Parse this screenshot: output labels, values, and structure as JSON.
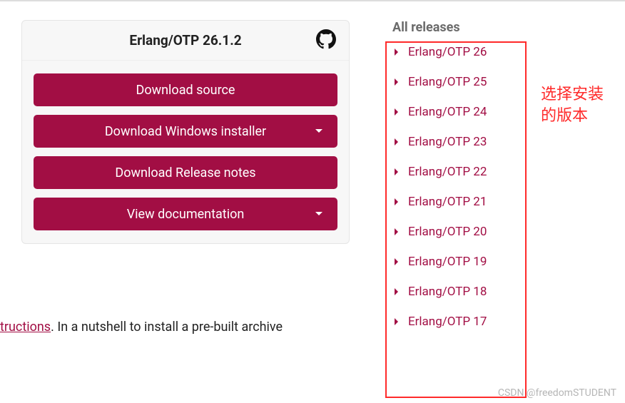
{
  "card": {
    "title": "Erlang/OTP 26.1.2",
    "github_icon": "github-icon",
    "buttons": [
      {
        "label": "Download source",
        "has_caret": false
      },
      {
        "label": "Download Windows installer",
        "has_caret": true
      },
      {
        "label": "Download Release notes",
        "has_caret": false
      },
      {
        "label": "View documentation",
        "has_caret": true
      }
    ]
  },
  "sidebar": {
    "title": "All releases",
    "items": [
      "Erlang/OTP 26",
      "Erlang/OTP 25",
      "Erlang/OTP 24",
      "Erlang/OTP 23",
      "Erlang/OTP 22",
      "Erlang/OTP 21",
      "Erlang/OTP 20",
      "Erlang/OTP 19",
      "Erlang/OTP 18",
      "Erlang/OTP 17"
    ]
  },
  "annotation": "选择安装的版本",
  "footer": {
    "link_text": "tructions",
    "rest": ". In a nutshell to install a pre-built archive"
  },
  "watermark": "CSDN @freedomSTUDENT"
}
